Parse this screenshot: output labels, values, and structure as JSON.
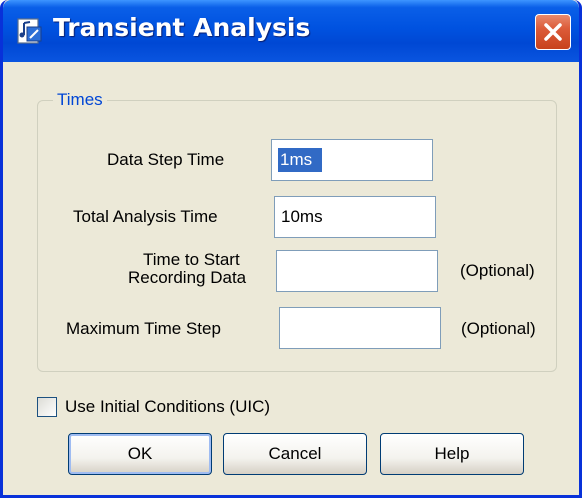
{
  "window": {
    "title": "Transient Analysis",
    "app_icon": "document-music-icon",
    "close_icon": "close-icon",
    "colors": {
      "titlebar": "#0054e3",
      "close": "#dc5b39",
      "face": "#ece9d8",
      "group_label": "#0046d5"
    }
  },
  "times_group": {
    "label": "Times",
    "fields": [
      {
        "label": "Data Step Time",
        "value": "1ms",
        "note": ""
      },
      {
        "label": "Total Analysis Time",
        "value": "10ms",
        "note": ""
      },
      {
        "label_line1": "Time to Start",
        "label_line2": "Recording Data",
        "value": "",
        "note": "(Optional)"
      },
      {
        "label": "Maximum Time Step",
        "value": "",
        "note": "(Optional)"
      }
    ]
  },
  "uic_checkbox": {
    "label": "Use Initial Conditions (UIC)",
    "checked": false
  },
  "buttons": {
    "ok": "OK",
    "cancel": "Cancel",
    "help": "Help"
  }
}
